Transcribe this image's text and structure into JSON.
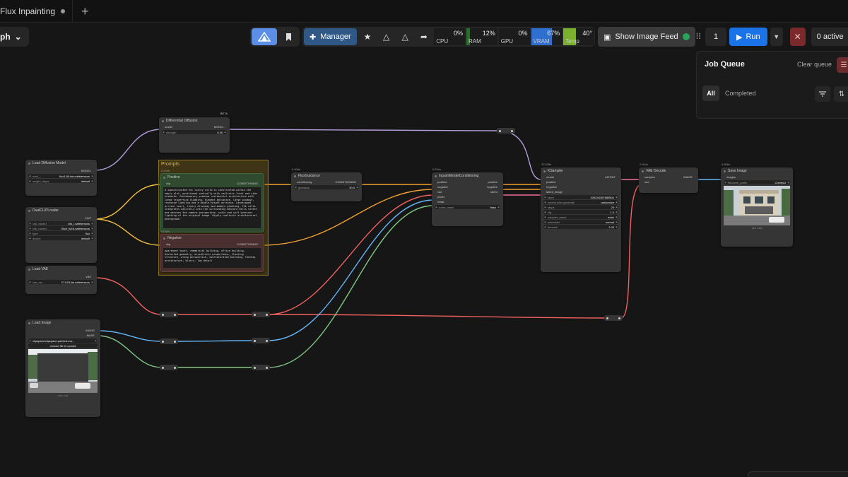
{
  "tabs": [
    {
      "title": "Flux Inpainting",
      "modified": true
    }
  ],
  "tab_add": "+",
  "graph_selector": {
    "label": "ph",
    "chevron": "⌄"
  },
  "toolbar": {
    "manager_label": "Manager",
    "stats": [
      {
        "label": "CPU",
        "percent": "0%",
        "fill": 0.0,
        "color": "#3b6e3b"
      },
      {
        "label": "RAM",
        "percent": "12%",
        "fill": 0.12,
        "color": "#2e6b2e"
      },
      {
        "label": "GPU",
        "percent": "0%",
        "fill": 0.0,
        "color": "#3b6e3b"
      },
      {
        "label": "VRAM",
        "percent": "67%",
        "fill": 0.67,
        "color": "#2f6fd0"
      },
      {
        "label": "Temp",
        "percent": "40°",
        "fill": 0.4,
        "color": "#7ab02d"
      }
    ],
    "feed_label": "Show Image Feed",
    "batch_count": "1",
    "run_label": "Run",
    "active_label": "0 active"
  },
  "queue": {
    "title": "Job Queue",
    "clear_label": "Clear queue",
    "tab_all": "All",
    "tab_completed": "Completed"
  },
  "nodes": {
    "diff_diffusion": {
      "title": "Differential Diffusion",
      "badge": "BETA",
      "in_model": "model",
      "out_model": "MODEL",
      "strength_name": "strength",
      "strength_val": "0.30"
    },
    "load_diffusion": {
      "title": "Load Diffusion Model",
      "out": "MODEL",
      "unet_name": "unet_...",
      "unet_val": "flux1-fill-dev.safetensors",
      "dtype_name": "weight_dtype",
      "dtype_val": "default"
    },
    "dual_clip": {
      "title": "DualCLIPLoader",
      "out": "CLIP",
      "clip1_name": "clip_name1",
      "clip1_val": "clip_l.safetensors",
      "clip2_name": "clip_name2",
      "clip2_val": "t5xxl_fp16.safetensors",
      "type_name": "type",
      "type_val": "flux",
      "device_name": "device",
      "device_val": "default"
    },
    "load_vae": {
      "title": "Load VAE",
      "out": "VAE",
      "vae_name": "vae_na...",
      "vae_val": "FLUX1/ae.safetensors"
    },
    "load_image": {
      "title": "Load Image",
      "out_image": "IMAGE",
      "out_mask": "MASK",
      "image_val": "clipspace/clipspace-painted-ma...",
      "upload_label": "choose file to upload",
      "caption": "1472 × 941"
    },
    "prompts_group": {
      "title": "Prompts"
    },
    "positive": {
      "title": "Positive",
      "time": "0.204s",
      "in": "clip",
      "out": "CONDITIONING",
      "text": "A sophisticated Evi luxury villa is constructed within the empty plot, positioned centrally with realistic front and side setbacks. Contemporary premium residential architecture with large travertine cladding, elegant balconies, large windows, recessed lighting and a double-height entrance. Landscaped arrival court, luxury driveway and modern planting. The villa integrates naturally into the surrounding Banjara Hills street and matches the camera perspective, scale and soft overcast lighting of the original image. Highly realistic architectural photograph."
    },
    "negative": {
      "title": "Negative",
      "time": "0.084s",
      "in": "clip",
      "out": "CONDITIONING",
      "text": "apartment tower, commercial building, office building, distorted geometry, unrealistic proportions, floating structure, wrong perspective, oversaturated building, fantasy architecture, blurry, low detail"
    },
    "flux_guidance": {
      "title": "FluxGuidance",
      "time": "0.008s",
      "in": "conditioning",
      "out": "CONDITIONING",
      "guid_name": "guidance",
      "guid_val": "30.0"
    },
    "inpaint_cond": {
      "title": "InpaintModelConditioning",
      "time": "0.634s",
      "in_positive": "positive",
      "in_negative": "negative",
      "in_vae": "vae",
      "in_pixels": "pixels",
      "in_mask": "mask",
      "out_positive": "positive",
      "out_negative": "negative",
      "out_latent": "latent",
      "noise_name": "noise_mask",
      "noise_val": "false"
    },
    "ksampler": {
      "title": "KSampler",
      "time": "23.038s",
      "in_model": "model",
      "in_positive": "positive",
      "in_negative": "negative",
      "in_latent": "latent_image",
      "out": "LATENT",
      "seed_name": "seed",
      "seed_val": "434244367885604",
      "cag_name": "control after generate",
      "cag_val": "randomize",
      "steps_name": "steps",
      "steps_val": "20",
      "cfg_name": "cfg",
      "cfg_val": "1.0",
      "sampler_name": "sampler_name",
      "sampler_val": "euler",
      "scheduler_name": "scheduler",
      "scheduler_val": "normal",
      "denoise_name": "denoise",
      "denoise_val": "1.00"
    },
    "vae_decode": {
      "title": "VAE Decode",
      "time": "0.404s",
      "in_samples": "samples",
      "in_vae": "vae",
      "out": "IMAGE"
    },
    "save_image": {
      "title": "Save Image",
      "time": "0.808s",
      "in": "images",
      "prefix_name": "filename_prefix",
      "prefix_val": "ComfyUI",
      "caption": "1472 × 896"
    }
  }
}
